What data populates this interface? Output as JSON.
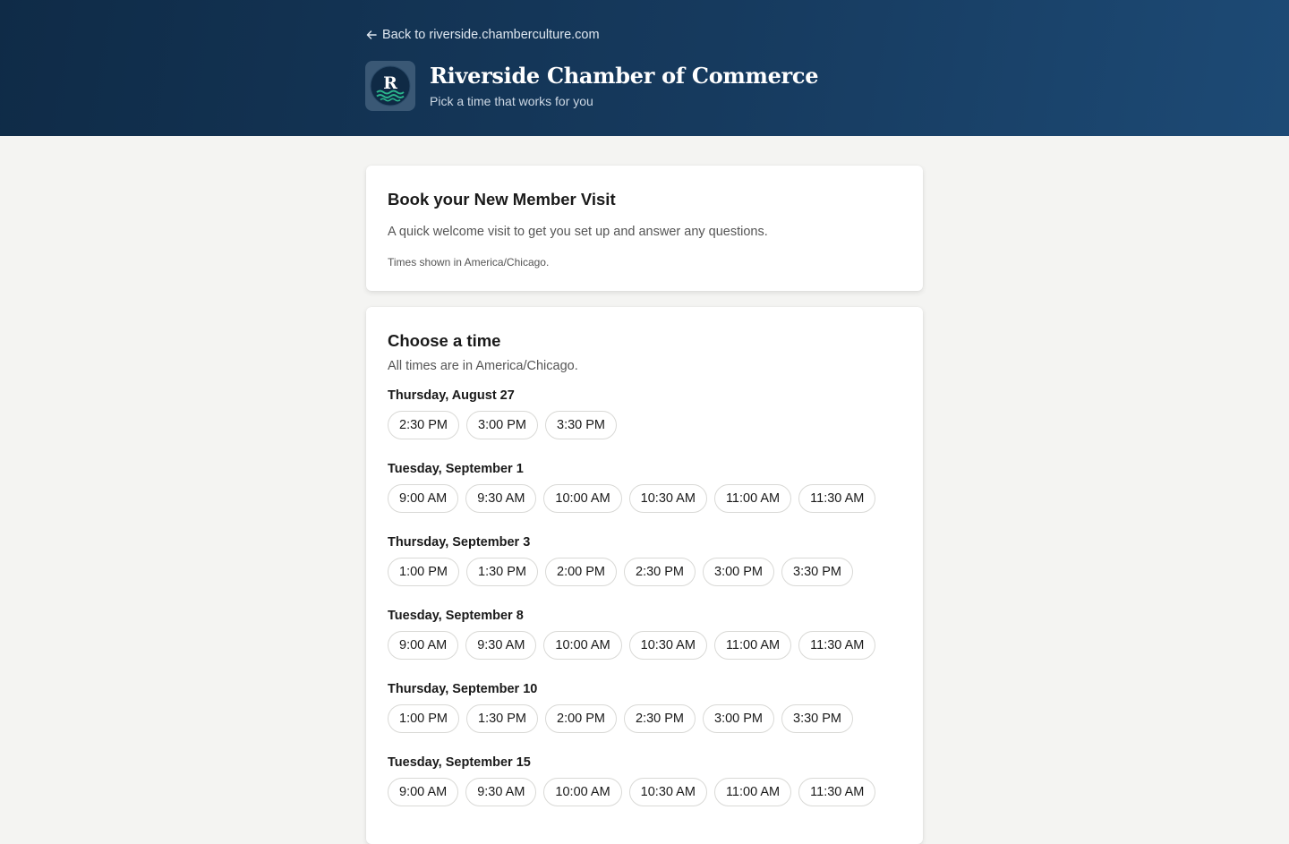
{
  "header": {
    "back_link": "Back to riverside.chamberculture.com",
    "org_name": "Riverside Chamber of Commerce",
    "org_subtitle": "Pick a time that works for you",
    "logo_letter": "R"
  },
  "intro": {
    "title": "Book your New Member Visit",
    "description": "A quick welcome visit to get you set up and answer any questions.",
    "timezone_note": "Times shown in America/Chicago."
  },
  "times": {
    "title": "Choose a time",
    "subtitle": "All times are in America/Chicago.",
    "days": [
      {
        "label": "Thursday, August 27",
        "slots": [
          "2:30 PM",
          "3:00 PM",
          "3:30 PM"
        ]
      },
      {
        "label": "Tuesday, September 1",
        "slots": [
          "9:00 AM",
          "9:30 AM",
          "10:00 AM",
          "10:30 AM",
          "11:00 AM",
          "11:30 AM"
        ]
      },
      {
        "label": "Thursday, September 3",
        "slots": [
          "1:00 PM",
          "1:30 PM",
          "2:00 PM",
          "2:30 PM",
          "3:00 PM",
          "3:30 PM"
        ]
      },
      {
        "label": "Tuesday, September 8",
        "slots": [
          "9:00 AM",
          "9:30 AM",
          "10:00 AM",
          "10:30 AM",
          "11:00 AM",
          "11:30 AM"
        ]
      },
      {
        "label": "Thursday, September 10",
        "slots": [
          "1:00 PM",
          "1:30 PM",
          "2:00 PM",
          "2:30 PM",
          "3:00 PM",
          "3:30 PM"
        ]
      },
      {
        "label": "Tuesday, September 15",
        "slots": [
          "9:00 AM",
          "9:30 AM",
          "10:00 AM",
          "10:30 AM",
          "11:00 AM",
          "11:30 AM"
        ]
      }
    ]
  },
  "colors": {
    "header_dark": "#0f2b47",
    "header_light": "#1d4a75",
    "page_bg": "#f4f4f2",
    "logo_wave": "#2bb58c"
  }
}
